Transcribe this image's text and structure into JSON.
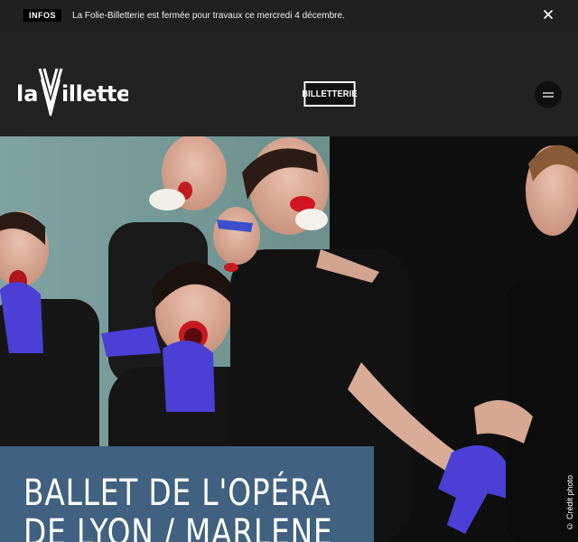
{
  "info_bar": {
    "badge": "INFOS",
    "message": "La Folie-Billetterie est fermée pour travaux ce mercredi 4 décembre.",
    "close_icon": "close-icon"
  },
  "header": {
    "logo_text": "laVillette",
    "billetterie_label": "BILLETTERIE",
    "menu_icon": "menu-icon"
  },
  "hero": {
    "title": "BALLET DE L'OPÉRA DE LYON / MARLENE",
    "credit": "© Crédit photo"
  },
  "colors": {
    "background": "#222222",
    "title_card": "#40617f",
    "glove": "#4b3fd6",
    "lips": "#e0122a"
  }
}
